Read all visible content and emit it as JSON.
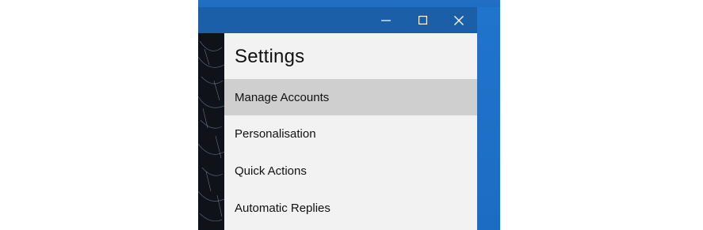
{
  "window": {
    "controls": {
      "minimize_icon": "minimize-icon",
      "maximize_icon": "maximize-icon",
      "close_icon": "close-icon"
    }
  },
  "settings": {
    "title": "Settings",
    "items": [
      {
        "label": "Manage Accounts",
        "selected": true
      },
      {
        "label": "Personalisation",
        "selected": false
      },
      {
        "label": "Quick Actions",
        "selected": false
      },
      {
        "label": "Automatic Replies",
        "selected": false
      }
    ]
  },
  "colors": {
    "titlebar": "#1a5fa8",
    "desktop": "#1f6fc4",
    "panel_bg": "#f2f2f2",
    "selected_bg": "#cfcfcf",
    "text": "#111111"
  }
}
